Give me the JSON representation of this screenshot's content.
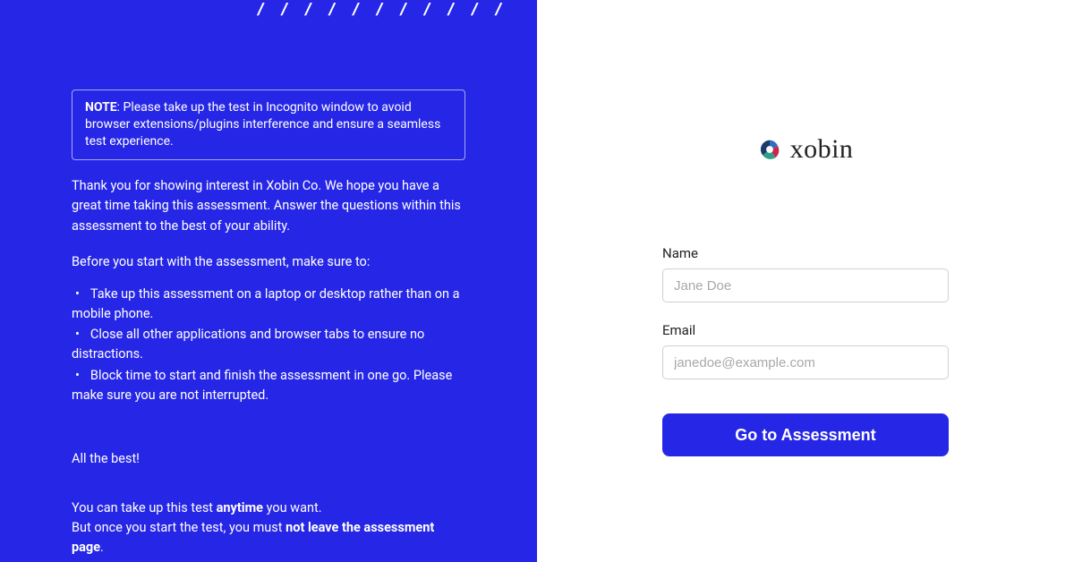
{
  "left": {
    "note_label": "NOTE",
    "note_text": ": Please take up the test in Incognito window to avoid browser extensions/plugins interference and ensure a seamless test experience.",
    "intro": "Thank you for showing interest in Xobin Co. We hope you have a great time taking this assessment. Answer the questions within this assessment to the best of your ability.",
    "pre_list": "Before you start with the assessment, make sure to:",
    "items": [
      "Take up this assessment on a laptop or desktop rather than on a mobile phone.",
      "Close all other applications and browser tabs to ensure no distractions.",
      "Block time to start and finish the assessment in one go. Please make sure you are not interrupted."
    ],
    "closing": "All the best!",
    "warn1_a": "You can take up this test ",
    "warn1_b": "anytime",
    "warn1_c": " you want.",
    "warn2_a": "But once you start the test, you must ",
    "warn2_b": "not leave the assessment page",
    "warn2_c": "."
  },
  "right": {
    "brand": "xobin",
    "name_label": "Name",
    "name_placeholder": "Jane Doe",
    "email_label": "Email",
    "email_placeholder": "janedoe@example.com",
    "submit_label": "Go to Assessment"
  }
}
